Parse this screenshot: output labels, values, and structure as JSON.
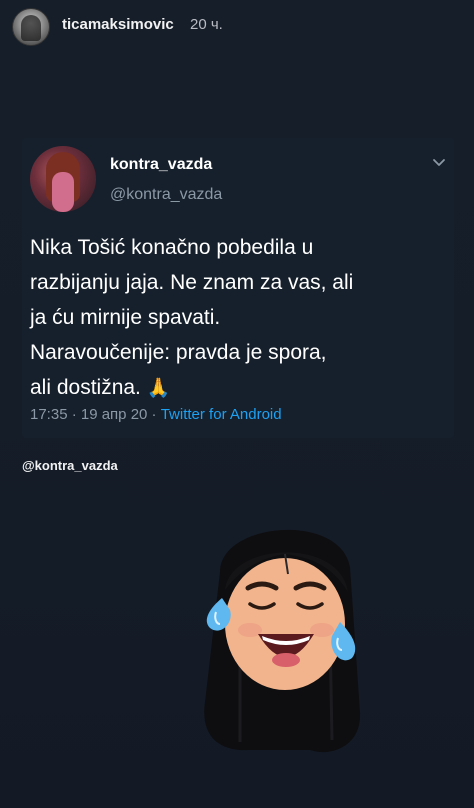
{
  "story": {
    "username": "ticamaksimovic",
    "time_ago": "20 ч."
  },
  "tweet": {
    "display_name": "kontra_vazda",
    "handle": "@kontra_vazda",
    "text": "Nika Tošić konačno pobedila u\nrazbijanju jaja. Ne znam za vas, ali\nja ću mirnije spavati.\nNaravoučenije: pravda je spora,\nali dostižna. ",
    "emoji": "🙏",
    "time": "17:35 · 19 апр 20 · ",
    "source": "Twitter for Android"
  },
  "mention": "@kontra_vazda",
  "icons": {
    "tweet_menu": "chevron-down-icon",
    "sticker": "laughing-memoji-sticker"
  },
  "colors": {
    "background": "#141c27",
    "link": "#1da1f2",
    "secondary_text": "#8b98a5"
  }
}
